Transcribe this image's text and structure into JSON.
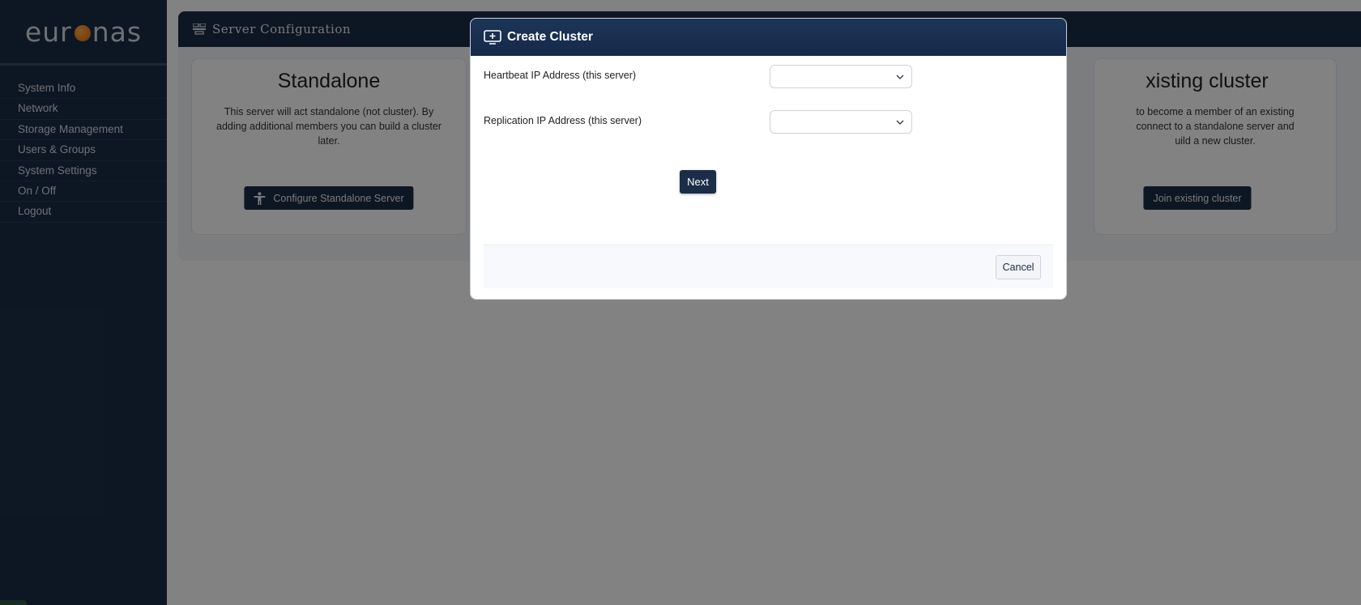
{
  "sidebar": {
    "logo_left": "eur",
    "logo_right": "nas",
    "items": [
      {
        "label": "System Info"
      },
      {
        "label": "Network"
      },
      {
        "label": "Storage Management"
      },
      {
        "label": "Users & Groups"
      },
      {
        "label": "System Settings"
      },
      {
        "label": "On / Off"
      },
      {
        "label": "Logout"
      }
    ]
  },
  "header": {
    "title": "Server  Configuration",
    "icon": "server-config-icon"
  },
  "cards": {
    "standalone": {
      "title": "Standalone",
      "description": "This server will act standalone (not cluster). By adding additional members you can build a cluster later.",
      "button_label": "Configure Standalone Server",
      "button_icon": "person-icon"
    },
    "join": {
      "title": "xisting cluster",
      "description_lines": [
        "to become a member of an existing",
        "connect to a standalone server and",
        "uild a new cluster."
      ],
      "button_label": "Join existing cluster"
    }
  },
  "modal": {
    "title": "Create Cluster",
    "icon": "add-screen-icon",
    "heartbeat_label": "Heartbeat IP Address (this server)",
    "heartbeat_value": "",
    "replication_label": "Replication IP Address (this server)",
    "replication_value": "",
    "next_label": "Next",
    "cancel_label": "Cancel"
  },
  "colors": {
    "navy": "#1b2d47",
    "logo_orange": "#e8640c",
    "overlay": "rgba(0,0,0,0.49)"
  }
}
